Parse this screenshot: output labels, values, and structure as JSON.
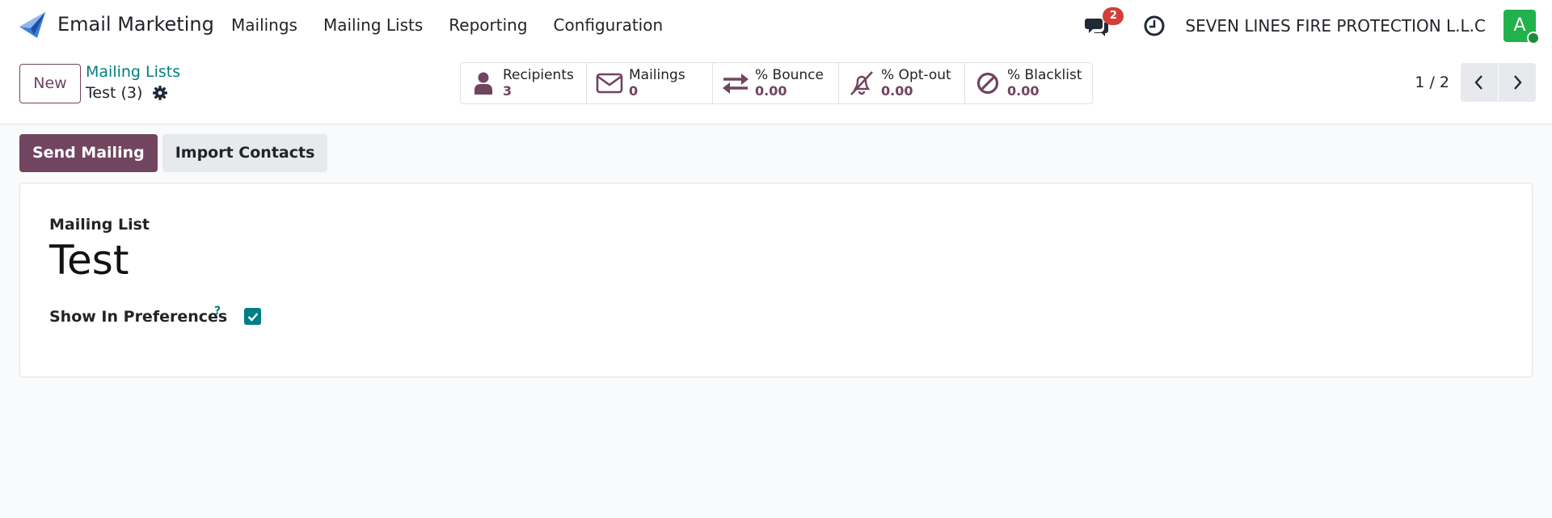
{
  "app": {
    "name": "Email Marketing"
  },
  "menu": [
    "Mailings",
    "Mailing Lists",
    "Reporting",
    "Configuration"
  ],
  "navbar": {
    "chat_badge": "2",
    "company": "SEVEN LINES FIRE PROTECTION L.L.C",
    "avatar_letter": "A"
  },
  "control": {
    "new_label": "New",
    "breadcrumb_parent": "Mailing Lists",
    "breadcrumb_current": "Test (3)",
    "stats": [
      {
        "label": "Recipients",
        "value": "3",
        "icon": "user-icon"
      },
      {
        "label": "Mailings",
        "value": "0",
        "icon": "envelope-icon"
      },
      {
        "label": "% Bounce",
        "value": "0.00",
        "icon": "exchange-icon"
      },
      {
        "label": "% Opt-out",
        "value": "0.00",
        "icon": "bell-slash-icon"
      },
      {
        "label": "% Blacklist",
        "value": "0.00",
        "icon": "ban-icon"
      }
    ],
    "pager": "1 / 2"
  },
  "actions": {
    "send_mailing": "Send Mailing",
    "import_contacts": "Import Contacts"
  },
  "form": {
    "name_label": "Mailing List",
    "name_value": "Test",
    "pref_label": "Show In Preferences",
    "pref_help": "?",
    "pref_checked": true
  },
  "colors": {
    "primary": "#71445f",
    "accent": "#017e84",
    "badge": "#d23f3a",
    "avatar": "#21b24b"
  }
}
